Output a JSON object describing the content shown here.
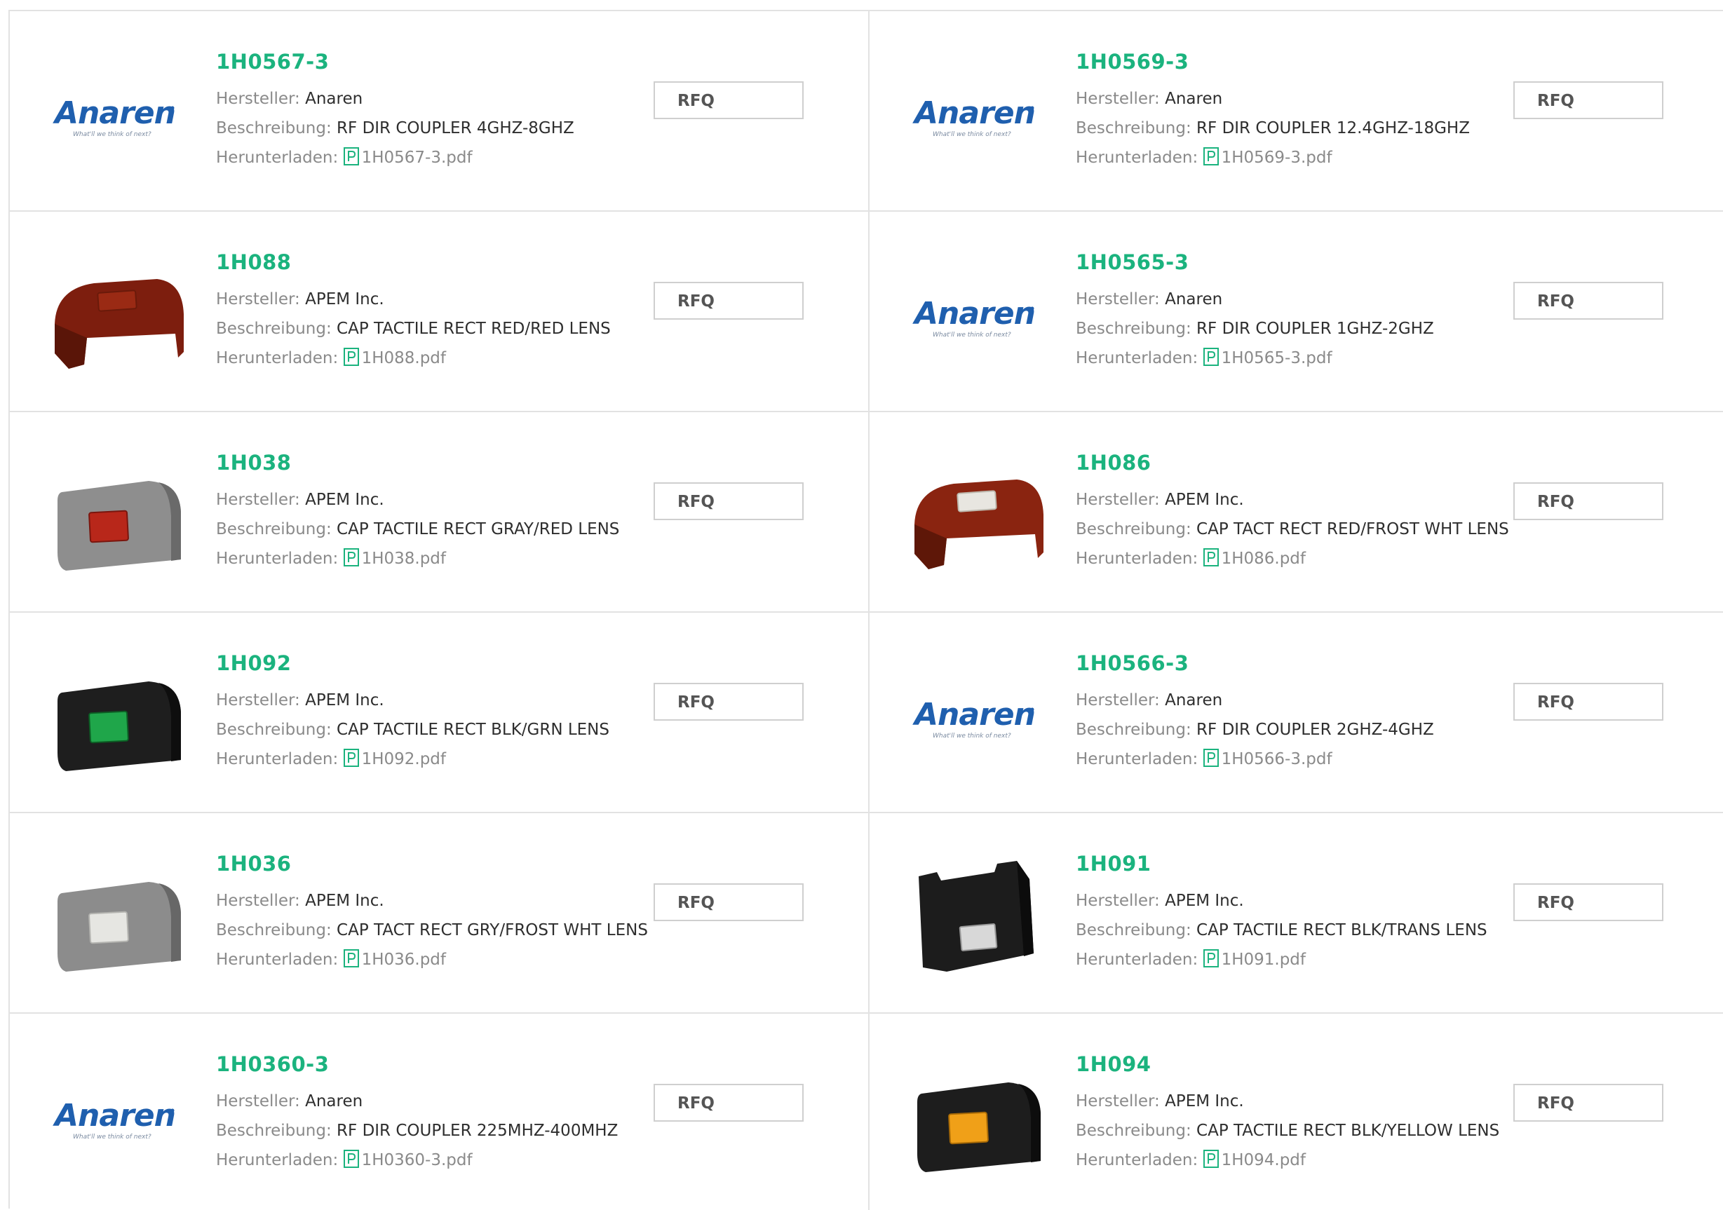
{
  "labels": {
    "manufacturer": "Hersteller:",
    "description": "Beschreibung:",
    "download": "Herunterladen:",
    "rfq": "RFQ"
  },
  "logo": {
    "brand": "Anaren",
    "tagline": "What'll we think of next?"
  },
  "colors": {
    "accent": "#1bb37e",
    "label": "#8a8a8a",
    "value": "#2e2e2e",
    "border": "#e2e2e2",
    "anaren_blue": "#1f5fae"
  },
  "products": [
    {
      "part": "1H0567-3",
      "manufacturer": "Anaren",
      "description": "RF DIR COUPLER 4GHZ-8GHZ",
      "file": "1H0567-3.pdf",
      "image": "anaren-logo"
    },
    {
      "part": "1H0569-3",
      "manufacturer": "Anaren",
      "description": "RF DIR COUPLER 12.4GHZ-18GHZ",
      "file": "1H0569-3.pdf",
      "image": "anaren-logo"
    },
    {
      "part": "1H088",
      "manufacturer": "APEM Inc.",
      "description": "CAP TACTILE RECT RED/RED LENS",
      "file": "1H088.pdf",
      "image": "cap-red-red"
    },
    {
      "part": "1H0565-3",
      "manufacturer": "Anaren",
      "description": "RF DIR COUPLER 1GHZ-2GHZ",
      "file": "1H0565-3.pdf",
      "image": "anaren-logo"
    },
    {
      "part": "1H038",
      "manufacturer": "APEM Inc.",
      "description": "CAP TACTILE RECT GRAY/RED LENS",
      "file": "1H038.pdf",
      "image": "cap-gray-red"
    },
    {
      "part": "1H086",
      "manufacturer": "APEM Inc.",
      "description": "CAP TACT RECT RED/FROST WHT LENS",
      "file": "1H086.pdf",
      "image": "cap-red-frost"
    },
    {
      "part": "1H092",
      "manufacturer": "APEM Inc.",
      "description": "CAP TACTILE RECT BLK/GRN LENS",
      "file": "1H092.pdf",
      "image": "cap-black-green"
    },
    {
      "part": "1H0566-3",
      "manufacturer": "Anaren",
      "description": "RF DIR COUPLER 2GHZ-4GHZ",
      "file": "1H0566-3.pdf",
      "image": "anaren-logo"
    },
    {
      "part": "1H036",
      "manufacturer": "APEM Inc.",
      "description": "CAP TACT RECT GRY/FROST WHT LENS",
      "file": "1H036.pdf",
      "image": "cap-gray-frost"
    },
    {
      "part": "1H091",
      "manufacturer": "APEM Inc.",
      "description": "CAP TACTILE RECT BLK/TRANS LENS",
      "file": "1H091.pdf",
      "image": "cap-black-trans"
    },
    {
      "part": "1H0360-3",
      "manufacturer": "Anaren",
      "description": "RF DIR COUPLER 225MHZ-400MHZ",
      "file": "1H0360-3.pdf",
      "image": "anaren-logo"
    },
    {
      "part": "1H094",
      "manufacturer": "APEM Inc.",
      "description": "CAP TACTILE RECT BLK/YELLOW LENS",
      "file": "1H094.pdf",
      "image": "cap-black-yellow"
    }
  ]
}
